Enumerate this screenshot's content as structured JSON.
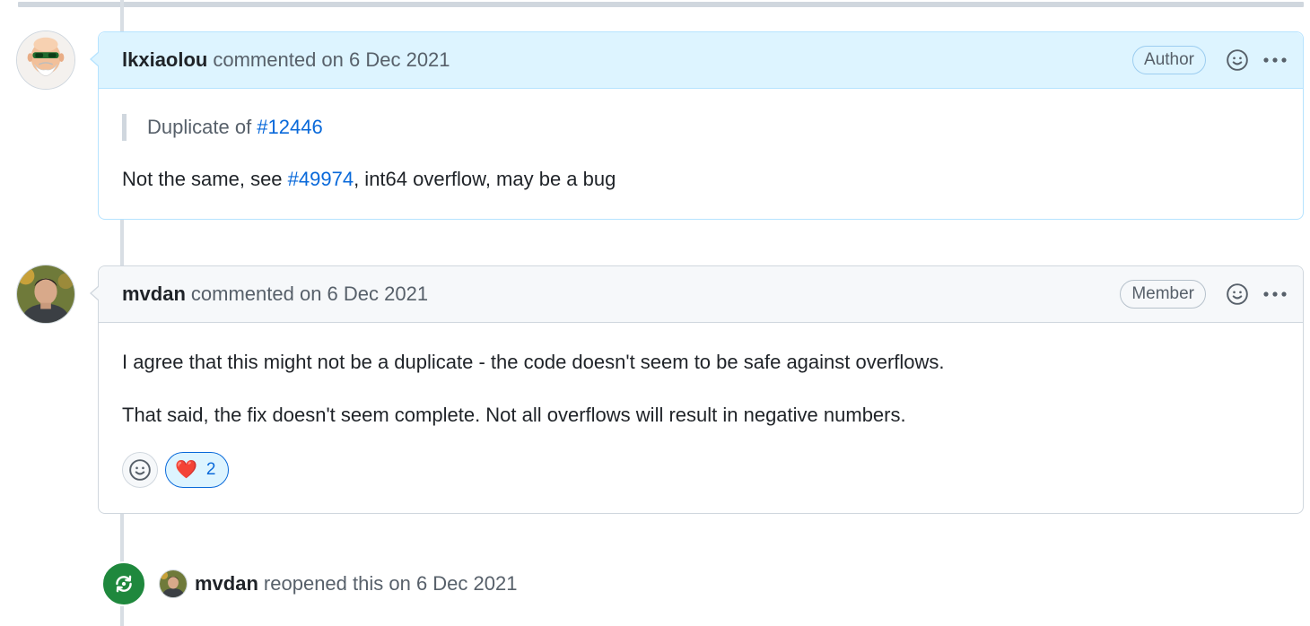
{
  "timeline": {
    "comments": [
      {
        "username": "lkxiaolou",
        "action": "commented on 6 Dec 2021",
        "role": "Author",
        "avatar_icon": "bald-man-sunglasses-avatar",
        "quote": {
          "prefix": "Duplicate of ",
          "link": "#12446"
        },
        "body": {
          "prefix": "Not the same, see ",
          "link": "#49974",
          "suffix": ", int64 overflow, may be a bug"
        }
      },
      {
        "username": "mvdan",
        "action": "commented on 6 Dec 2021",
        "role": "Member",
        "avatar_icon": "man-photo-avatar",
        "paragraphs": [
          "I agree that this might not be a duplicate - the code doesn't seem to be safe against overflows.",
          "That said, the fix doesn't seem complete. Not all overflows will result in negative numbers."
        ],
        "reactions": [
          {
            "emoji": "❤️",
            "icon": "heart-icon",
            "count": "2"
          }
        ]
      }
    ],
    "event": {
      "username": "mvdan",
      "action": "reopened this on 6 Dec 2021",
      "icon": "reopen-icon"
    }
  },
  "colors": {
    "author_header_bg": "#ddf4ff",
    "link": "#0969da",
    "reopen_green": "#1f883d"
  }
}
